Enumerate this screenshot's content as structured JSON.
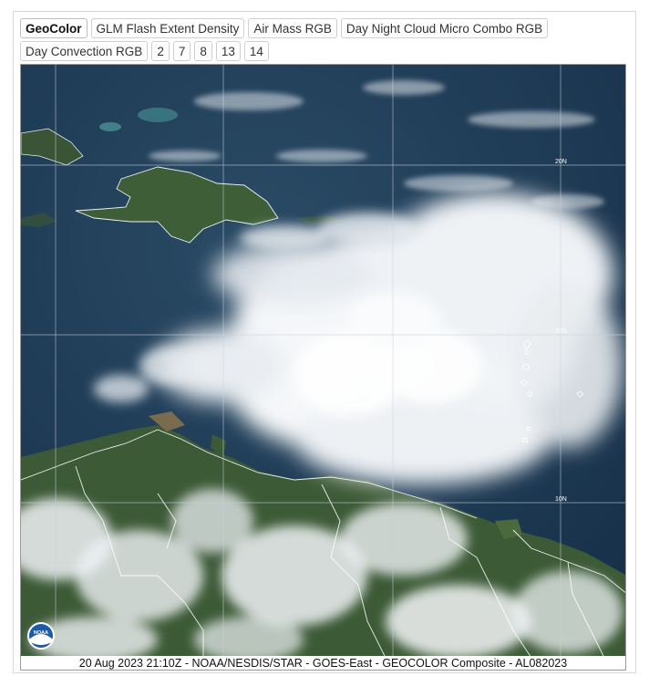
{
  "tabs_row1": [
    {
      "label": "GeoColor",
      "active": true
    },
    {
      "label": "GLM Flash Extent Density",
      "active": false
    },
    {
      "label": "Air Mass RGB",
      "active": false
    },
    {
      "label": "Day Night Cloud Micro Combo RGB",
      "active": false
    }
  ],
  "tabs_row2": [
    {
      "label": "Day Convection RGB",
      "active": false
    },
    {
      "label": "2",
      "active": false
    },
    {
      "label": "7",
      "active": false
    },
    {
      "label": "8",
      "active": false
    },
    {
      "label": "13",
      "active": false
    },
    {
      "label": "14",
      "active": false
    }
  ],
  "image": {
    "lat_labels": [
      "20N",
      "15N",
      "10N"
    ],
    "logo_text": "NOAA",
    "colors": {
      "ocean": "#1e3a52",
      "land": "#3f5c39",
      "cloud": "#f4f6f8",
      "grid": "#c9d2da",
      "coast": "#ffffff"
    }
  },
  "caption": "20 Aug 2023 21:10Z - NOAA/NESDIS/STAR - GOES-East - GEOCOLOR Composite - AL082023"
}
